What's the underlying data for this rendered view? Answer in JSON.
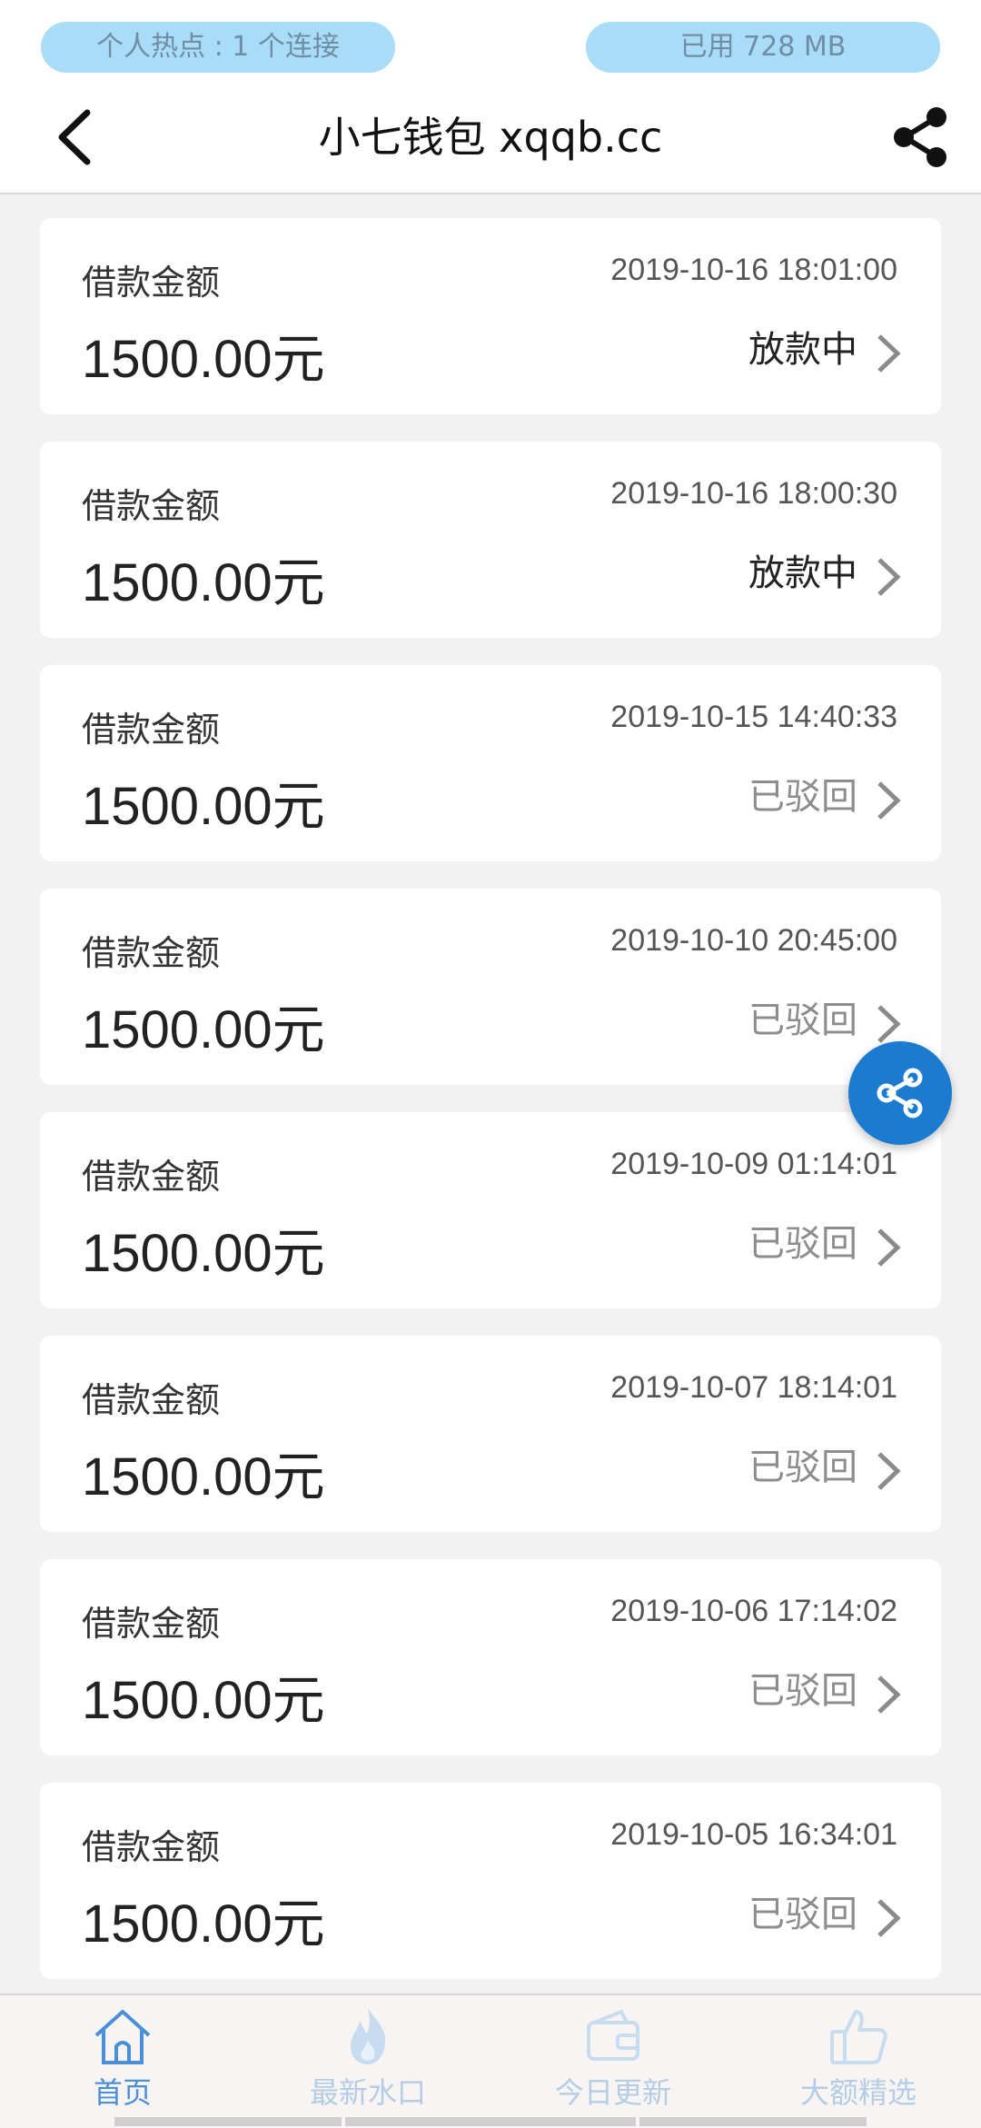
{
  "status_bar": {
    "hotspot": "个人热点 : 1 个连接",
    "data_used": "已用 728 MB"
  },
  "header": {
    "title": "小七钱包 xqqb.cc",
    "back_icon": "chevron-left-icon",
    "share_icon": "share-icon"
  },
  "loans": [
    {
      "label": "借款金额",
      "amount": "1500.00元",
      "time": "2019-10-16 18:01:00",
      "status": "放款中"
    },
    {
      "label": "借款金额",
      "amount": "1500.00元",
      "time": "2019-10-16 18:00:30",
      "status": "放款中"
    },
    {
      "label": "借款金额",
      "amount": "1500.00元",
      "time": "2019-10-15 14:40:33",
      "status": "已驳回"
    },
    {
      "label": "借款金额",
      "amount": "1500.00元",
      "time": "2019-10-10 20:45:00",
      "status": "已驳回"
    },
    {
      "label": "借款金额",
      "amount": "1500.00元",
      "time": "2019-10-09 01:14:01",
      "status": "已驳回"
    },
    {
      "label": "借款金额",
      "amount": "1500.00元",
      "time": "2019-10-07 18:14:01",
      "status": "已驳回"
    },
    {
      "label": "借款金额",
      "amount": "1500.00元",
      "time": "2019-10-06 17:14:02",
      "status": "已驳回"
    },
    {
      "label": "借款金额",
      "amount": "1500.00元",
      "time": "2019-10-05 16:34:01",
      "status": "已驳回"
    }
  ],
  "tabs": [
    {
      "label": "首页",
      "icon": "home-icon",
      "active": true
    },
    {
      "label": "最新水口",
      "icon": "flame-icon",
      "active": false
    },
    {
      "label": "今日更新",
      "icon": "wallet-icon",
      "active": false
    },
    {
      "label": "大额精选",
      "icon": "thumbs-up-icon",
      "active": false
    }
  ],
  "colors": {
    "accent": "#1b7bd0",
    "tab_active": "#4a90d9",
    "tab_inactive": "#b3cde5",
    "status_pill": "#a9dcf7"
  }
}
